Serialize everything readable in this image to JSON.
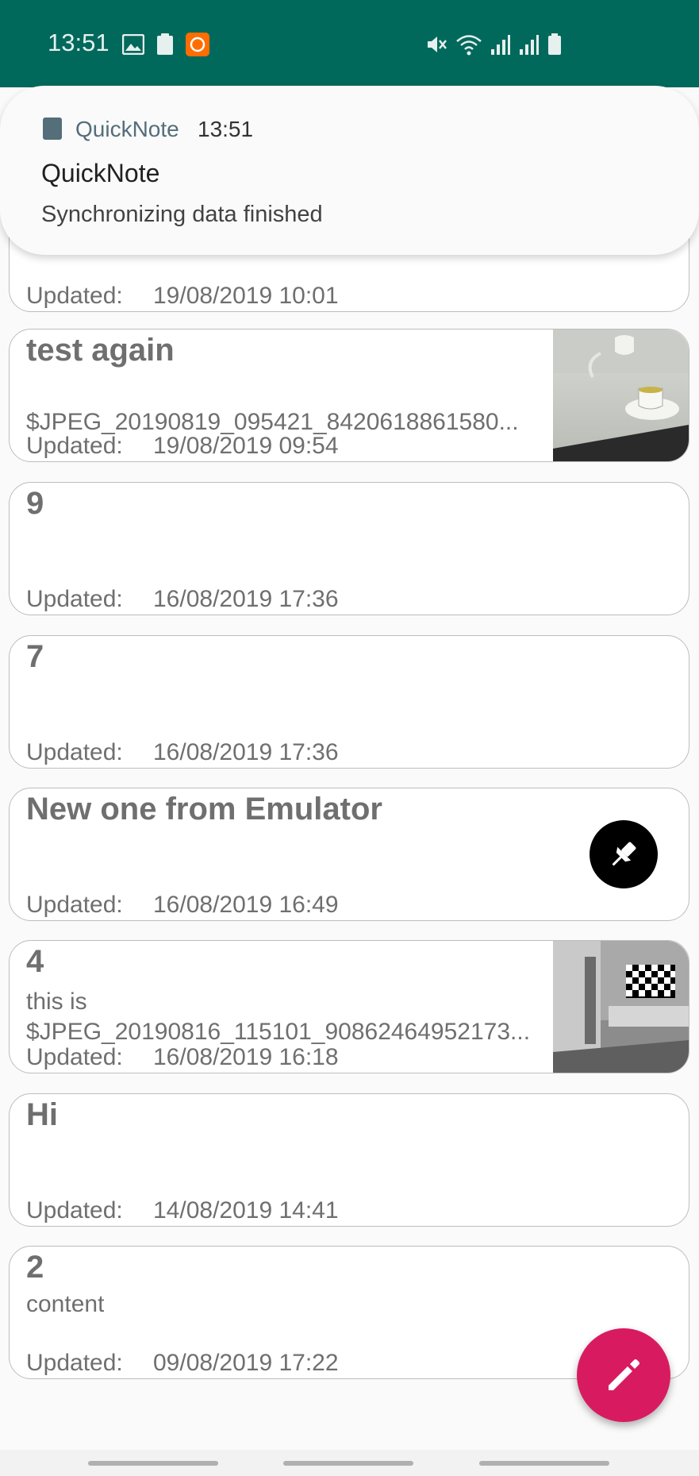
{
  "status_bar": {
    "time": "13:51",
    "left_icons": [
      "gallery-icon",
      "clipboard-icon",
      "mi-app-icon"
    ],
    "right_icons": [
      "mute-icon",
      "wifi-icon",
      "signal-icon",
      "signal-icon",
      "battery-icon"
    ],
    "background": "#00695c"
  },
  "notification": {
    "app_name": "QuickNote",
    "time": "13:51",
    "title": "QuickNote",
    "body": "Synchronizing data finished"
  },
  "notes": [
    {
      "title": "",
      "content": "",
      "updated_label": "Updated:",
      "updated": "19/08/2019 10:01",
      "thumbnail": false
    },
    {
      "title": "test again",
      "content": "$JPEG_20190819_095421_8420618861580...",
      "updated_label": "Updated:",
      "updated": "19/08/2019 09:54",
      "thumbnail": "teacup-photo"
    },
    {
      "title": "9",
      "content": "",
      "updated_label": "Updated:",
      "updated": "16/08/2019 17:36",
      "thumbnail": false
    },
    {
      "title": "7",
      "content": "",
      "updated_label": "Updated:",
      "updated": "16/08/2019 17:36",
      "thumbnail": false
    },
    {
      "title": "New one from Emulator",
      "content": "",
      "updated_label": "Updated:",
      "updated": "16/08/2019 16:49",
      "pinned": true
    },
    {
      "title": "4",
      "content_line1": "this is",
      "content": "$JPEG_20190816_115101_90862464952173...",
      "updated_label": "Updated:",
      "updated": "16/08/2019 16:18",
      "thumbnail": "room-photo"
    },
    {
      "title": "Hi",
      "content": "",
      "updated_label": "Updated:",
      "updated": "14/08/2019 14:41",
      "thumbnail": false
    },
    {
      "title": "2",
      "content": "content",
      "updated_label": "Updated:",
      "updated": "09/08/2019 17:22",
      "thumbnail": false
    }
  ],
  "fab": {
    "icon": "pencil-icon",
    "color": "#d81b60"
  },
  "pin_button": {
    "icon": "pin-icon"
  }
}
